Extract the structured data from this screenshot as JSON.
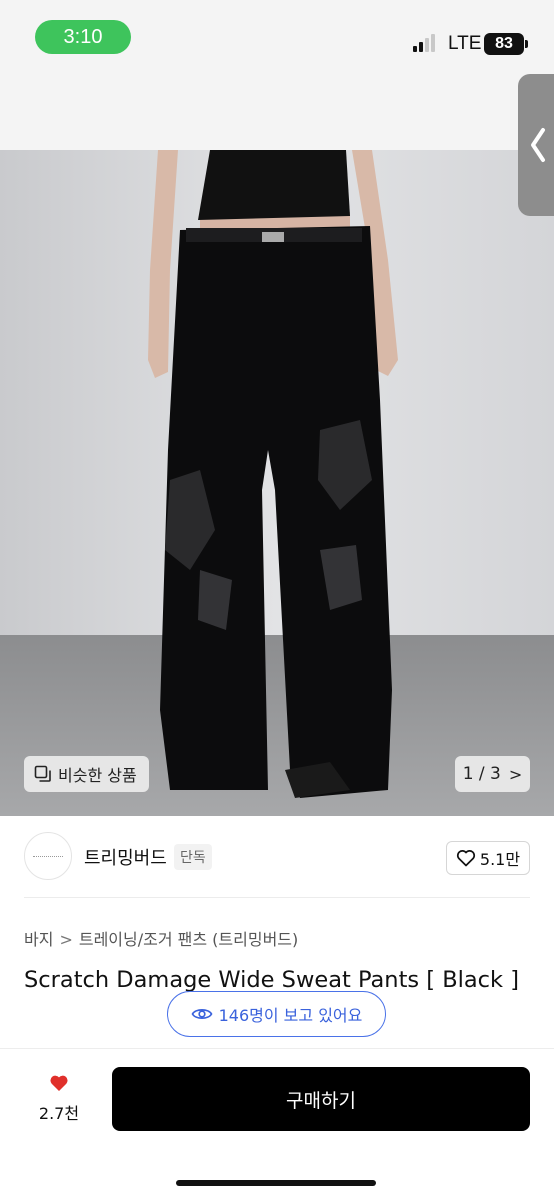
{
  "status_bar": {
    "time": "3:10",
    "network": "LTE",
    "battery": "83"
  },
  "image": {
    "similar_label": "비슷한 상품",
    "pager": "1 / 3",
    "pager_chevron": ">"
  },
  "seller": {
    "name": "트리밍버드",
    "badge": "단독",
    "likes": "5.1만"
  },
  "breadcrumb": {
    "category": "바지",
    "separator": ">",
    "subcategory": "트레이닝/조거 팬츠 (트리밍버드)"
  },
  "product": {
    "title": "Scratch Damage Wide Sweat Pants [ Black ]",
    "viewers": "146명이 보고 있어요"
  },
  "bottom_bar": {
    "wish_count": "2.7천",
    "buy_label": "구매하기"
  },
  "colors": {
    "time_pill": "#3ec45c",
    "viewers_accent": "#3a62dc",
    "heart": "#e0302b",
    "buy_button": "#000000"
  },
  "icons": [
    "back-chevron-icon",
    "similar-items-icon",
    "heart-outline-icon",
    "eye-icon",
    "heart-filled-icon"
  ]
}
